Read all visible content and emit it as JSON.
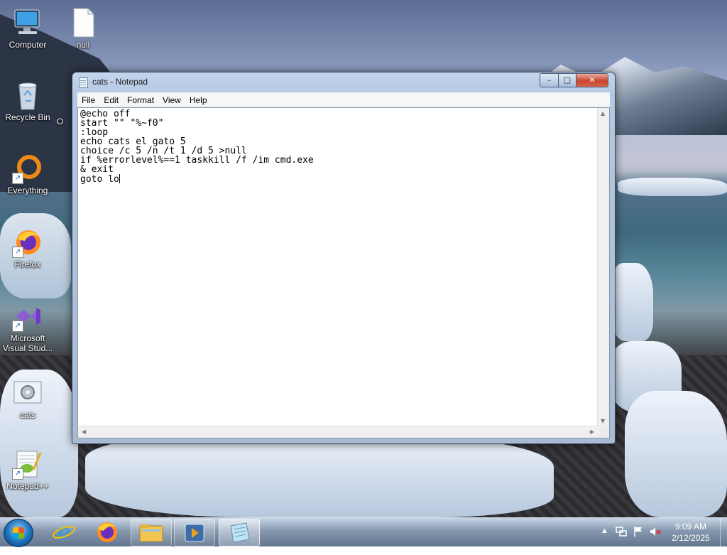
{
  "desktop": {
    "icons": [
      {
        "label": "Computer",
        "icon": "computer-icon"
      },
      {
        "label": "null",
        "icon": "blank-file-icon"
      },
      {
        "label": "Recycle Bin",
        "icon": "recycle-bin-icon"
      },
      {
        "label": "Everything",
        "icon": "everything-search-icon"
      },
      {
        "label": "Firefox",
        "icon": "firefox-icon"
      },
      {
        "label": "Microsoft Visual Stud...",
        "icon": "visual-studio-icon"
      },
      {
        "label": "cats",
        "icon": "batch-file-icon"
      },
      {
        "label": "Notepad++",
        "icon": "notepadpp-icon"
      }
    ],
    "partial_label": "O"
  },
  "window": {
    "title": "cats - Notepad",
    "controls": {
      "minimize": "–",
      "maximize": "□",
      "close": "✕"
    },
    "menu": [
      "File",
      "Edit",
      "Format",
      "View",
      "Help"
    ],
    "content": "@echo off\nstart \"\" \"%~f0\"\n:loop\necho cats el gato 5\nchoice /c 5 /n /t 1 /d 5 >null\nif %errorlevel%==1 taskkill /f /im cmd.exe\n& exit\ngoto lo"
  },
  "taskbar": {
    "pinned": [
      {
        "name": "internet-explorer-icon",
        "state": "pinned"
      },
      {
        "name": "firefox-icon",
        "state": "pinned"
      },
      {
        "name": "file-explorer-icon",
        "state": "open"
      },
      {
        "name": "media-player-icon",
        "state": "open"
      },
      {
        "name": "notepad-icon",
        "state": "active"
      }
    ],
    "tray": {
      "show_hidden": "▲"
    },
    "clock": {
      "time": "9:09 AM",
      "date": "2/12/2025"
    }
  },
  "colors": {
    "accent": "#1b6fb8",
    "close_button": "#c9452e"
  }
}
